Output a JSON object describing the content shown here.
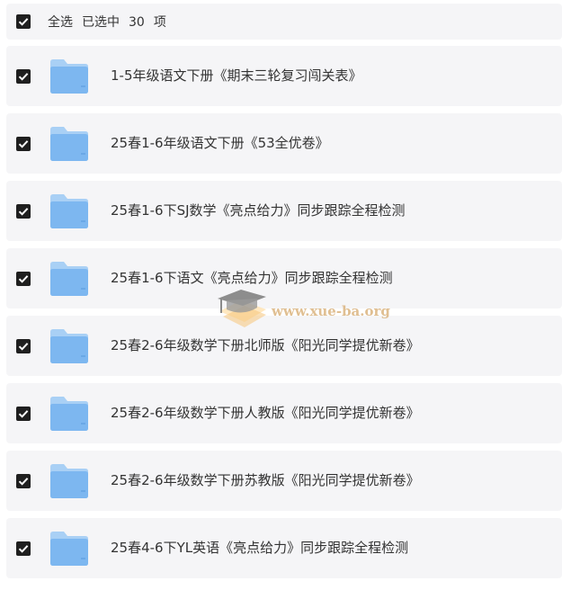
{
  "header": {
    "select_all_label": "全选",
    "selected_prefix": "已选中",
    "selected_count": "30",
    "selected_suffix": "项"
  },
  "items": [
    {
      "name": "1-5年级语文下册《期末三轮复习闯关表》",
      "checked": true,
      "icon": "folder-icon"
    },
    {
      "name": "25春1-6年级语文下册《53全优卷》",
      "checked": true,
      "icon": "folder-icon"
    },
    {
      "name": "25春1-6下SJ数学《亮点给力》同步跟踪全程检测",
      "checked": true,
      "icon": "folder-icon"
    },
    {
      "name": "25春1-6下语文《亮点给力》同步跟踪全程检测",
      "checked": true,
      "icon": "folder-icon"
    },
    {
      "name": "25春2-6年级数学下册北师版《阳光同学提优新卷》",
      "checked": true,
      "icon": "folder-icon"
    },
    {
      "name": "25春2-6年级数学下册人教版《阳光同学提优新卷》",
      "checked": true,
      "icon": "folder-icon"
    },
    {
      "name": "25春2-6年级数学下册苏教版《阳光同学提优新卷》",
      "checked": true,
      "icon": "folder-icon"
    },
    {
      "name": "25春4-6下YL英语《亮点给力》同步跟踪全程检测",
      "checked": true,
      "icon": "folder-icon"
    }
  ],
  "watermark": {
    "text": "www.xue-ba.org"
  },
  "colors": {
    "row_background": "#f5f5f7",
    "checkbox": "#1f1f1f",
    "folder_front": "#7db7f0",
    "folder_back": "#a9d0f5",
    "text": "#333333"
  }
}
